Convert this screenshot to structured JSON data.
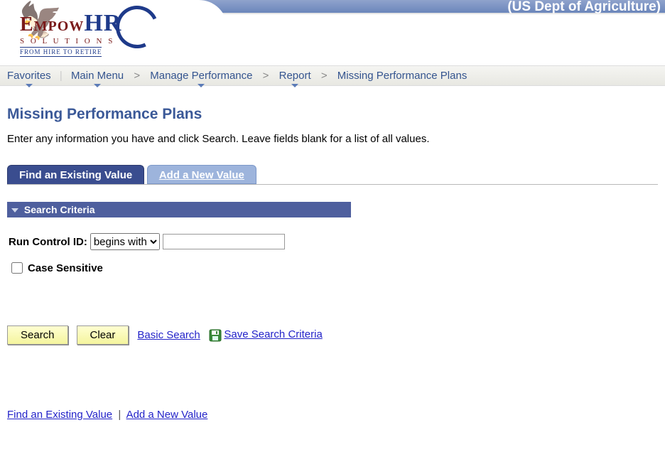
{
  "header": {
    "org_label": "(US Dept of Agriculture)",
    "logo": {
      "main1": "Empow",
      "main2": "HR",
      "sub1": "S O L U T I O N S",
      "sub2": "FROM HIRE TO RETIRE"
    }
  },
  "breadcrumb": {
    "favorites": "Favorites",
    "main_menu": "Main Menu",
    "items": [
      "Manage Performance",
      "Report",
      "Missing Performance Plans"
    ]
  },
  "page": {
    "title": "Missing Performance Plans",
    "instructions": "Enter any information you have and click Search. Leave fields blank for a list of all values."
  },
  "tabs": {
    "active": "Find an Existing Value",
    "inactive": "Add a New Value"
  },
  "search": {
    "section_title": "Search Criteria",
    "field_label": "Run Control ID:",
    "operator_options": [
      "begins with"
    ],
    "operator_selected": "begins with",
    "value": "",
    "case_sensitive_label": "Case Sensitive",
    "case_sensitive_checked": false
  },
  "actions": {
    "search": "Search",
    "clear": "Clear",
    "basic_search": "Basic Search",
    "save_criteria": "Save Search Criteria"
  },
  "bottom_links": {
    "find": "Find an Existing Value",
    "add": "Add a New Value"
  }
}
